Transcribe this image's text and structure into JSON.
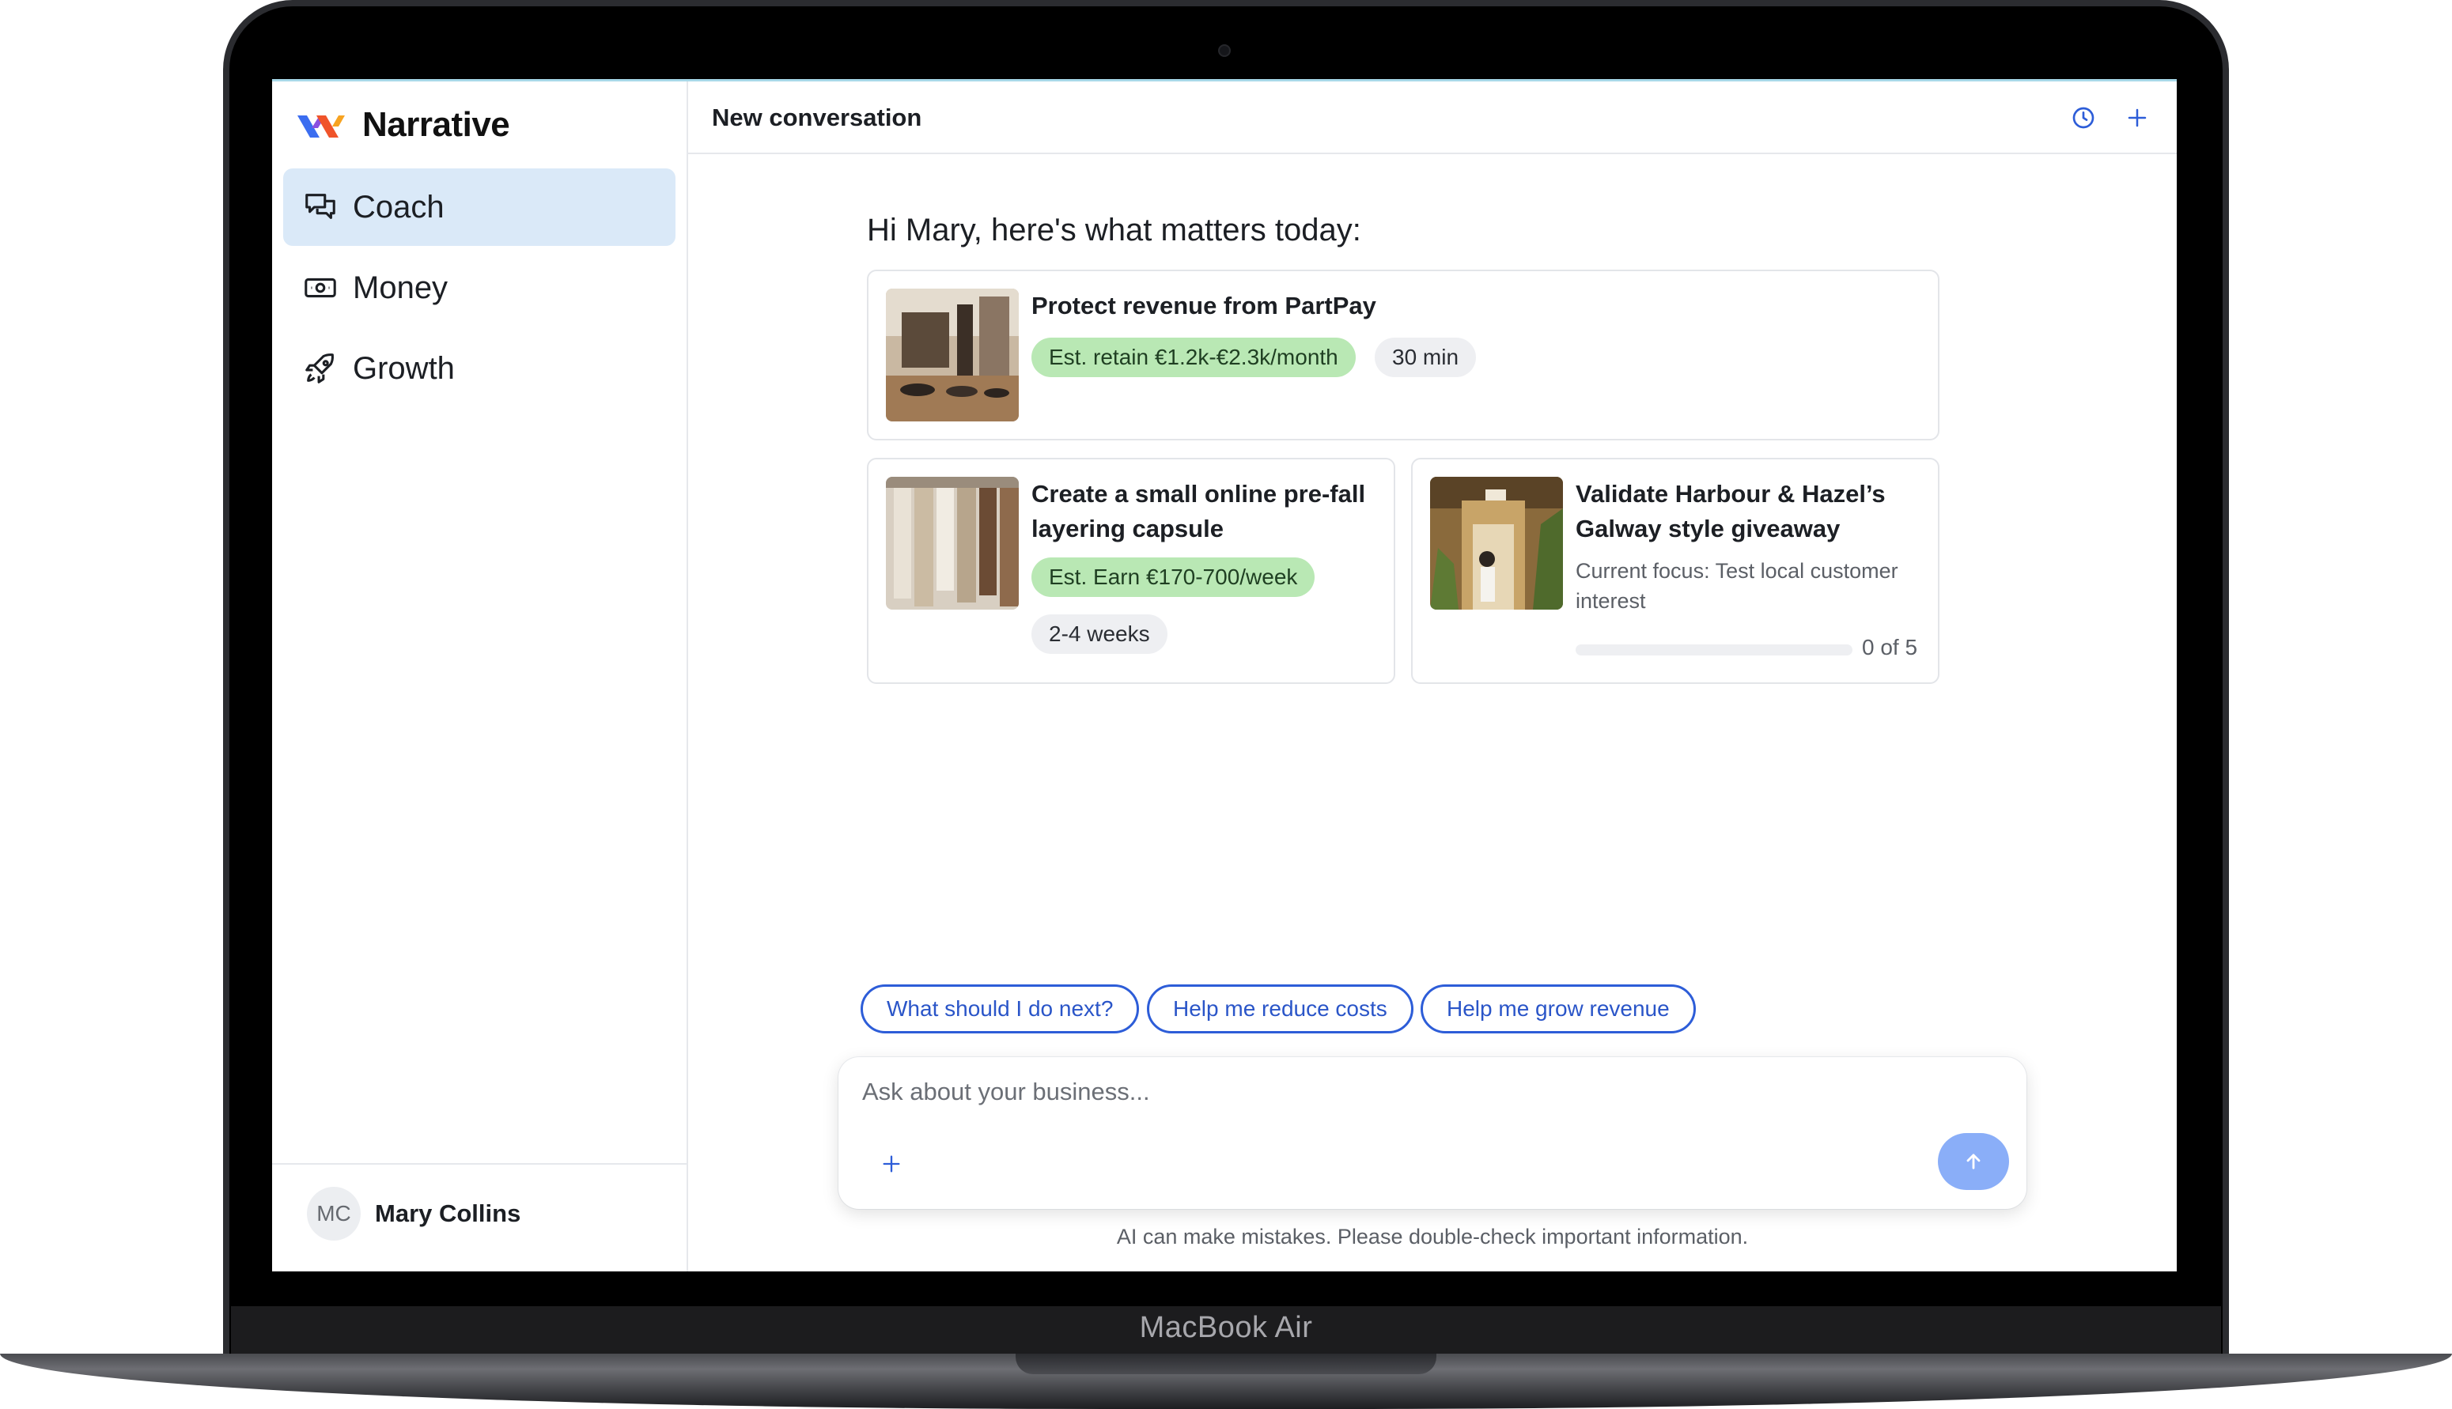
{
  "device": {
    "brand": "MacBook Air"
  },
  "sidebar": {
    "logo_text": "Narrative",
    "items": [
      {
        "label": "Coach",
        "icon": "chat-bubbles-icon",
        "active": true
      },
      {
        "label": "Money",
        "icon": "banknote-icon",
        "active": false
      },
      {
        "label": "Growth",
        "icon": "rocket-icon",
        "active": false
      }
    ],
    "user": {
      "initials": "MC",
      "name": "Mary Collins"
    }
  },
  "header": {
    "title": "New conversation",
    "icons": [
      "history-clock-icon",
      "new-plus-icon"
    ]
  },
  "main": {
    "greeting": "Hi Mary, here's what matters today:",
    "cards": [
      {
        "title": "Protect revenue from PartPay",
        "estimate": "Est. retain €1.2k-€2.3k/month",
        "duration": "30 min"
      },
      {
        "title": "Create a small online pre-fall layering capsule",
        "estimate": "Est. Earn €170-700/week",
        "duration": "2-4 weeks"
      },
      {
        "title": "Validate Harbour & Hazel’s Galway style giveaway",
        "focus": "Current focus: Test local customer interest",
        "progress": {
          "done": 0,
          "total": 5,
          "label": "0 of 5"
        }
      }
    ],
    "suggestions": [
      "What should I do next?",
      "Help me reduce costs",
      "Help me grow revenue"
    ],
    "composer": {
      "placeholder": "Ask about your business..."
    },
    "disclaimer": "AI can make mistakes. Please double-check important information."
  },
  "colors": {
    "accent": "#2d5dd8",
    "nav_active": "#dae9f8",
    "pill_green": "#b9e8b4",
    "send_button": "#8aaef8"
  }
}
